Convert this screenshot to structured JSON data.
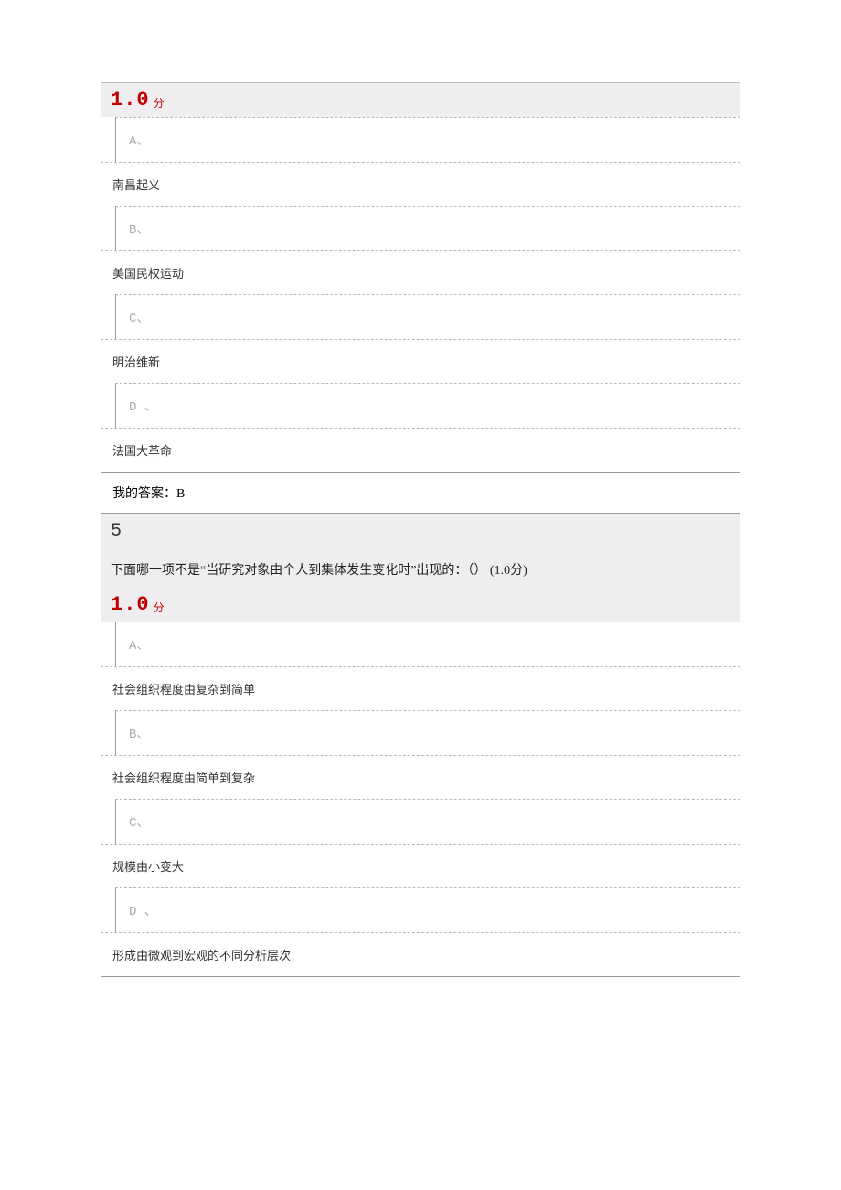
{
  "q4": {
    "score_value": "1.0",
    "score_unit": "分",
    "options": [
      {
        "letter": "A、",
        "text": "南昌起义"
      },
      {
        "letter": "B、",
        "text": "美国民权运动"
      },
      {
        "letter": "C、",
        "text": "明治维新"
      },
      {
        "letter": "D 、",
        "text": "法国大革命"
      }
    ],
    "my_answer_label": "我的答案：B"
  },
  "q5": {
    "number": "5",
    "text": "下面哪一项不是“当研究对象由个人到集体发生变化时”出现的：（） (1.0分)",
    "score_value": "1.0",
    "score_unit": "分",
    "options": [
      {
        "letter": "A、",
        "text": "社会组织程度由复杂到简单"
      },
      {
        "letter": "B、",
        "text": "社会组织程度由简单到复杂"
      },
      {
        "letter": "C、",
        "text": "规模由小变大"
      },
      {
        "letter": "D 、",
        "text": "形成由微观到宏观的不同分析层次"
      }
    ]
  }
}
